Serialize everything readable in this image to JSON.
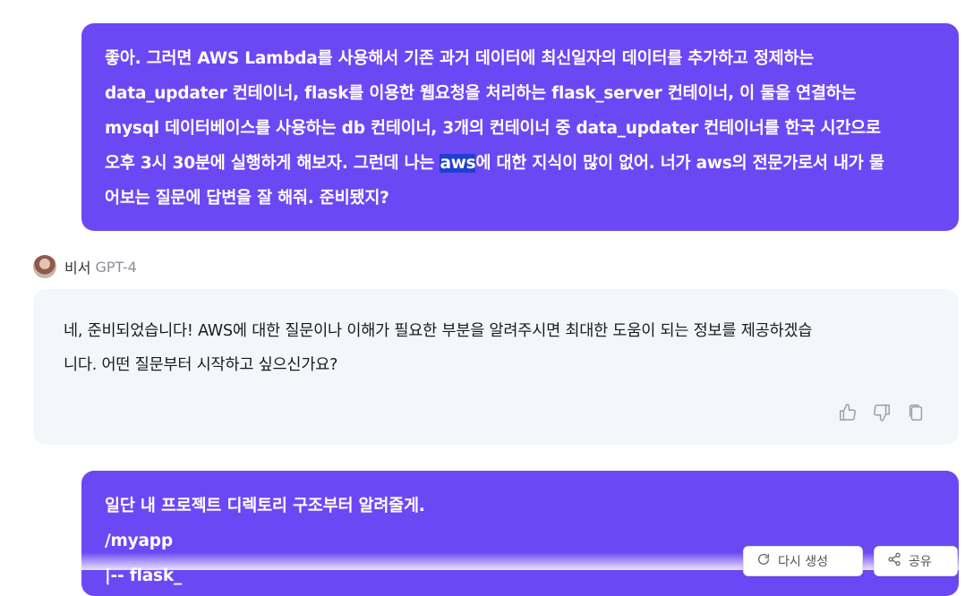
{
  "messages": {
    "user1": {
      "lines": [
        "좋아. 그러면 AWS Lambda를 사용해서 기존 과거 데이터에 최신일자의 데이터를 추가하고 정제하는",
        "data_updater 컨테이너,  flask를 이용한 웹요청을 처리하는 flask_server 컨테이너, 이 둘을 연결하는",
        "mysql 데이터베이스를 사용하는 db 컨테이너, 3개의 컨테이너 중 data_updater 컨테이너를 한국 시간으로"
      ],
      "line4_before": "오후 3시 30분에 실행하게 해보자. 그런데 나는 ",
      "line4_highlight": "aws",
      "line4_after": "에 대한 지식이 많이 없어. 너가 aws의 전문가로서 내가 물",
      "line5": "어보는 질문에 답변을 잘 해줘. 준비됐지?"
    },
    "assistant1": {
      "name": "비서",
      "model": "GPT-4",
      "lines": [
        "네, 준비되었습니다! AWS에 대한 질문이나 이해가 필요한 부분을 알려주시면 최대한 도움이 되는 정보를 제공하겠습",
        "니다. 어떤 질문부터 시작하고 싶으신가요?"
      ],
      "actions": [
        "thumbs-up-icon",
        "thumbs-down-icon",
        "copy-icon"
      ]
    },
    "user2": {
      "lines": [
        "일단 내 프로젝트 디렉토리 구조부터 알려줄게.",
        "/myapp",
        "|-- flask_"
      ]
    }
  },
  "floating_actions": {
    "regenerate": "다시 생성",
    "share": "공유"
  },
  "colors": {
    "user_bubble": "#6c48f5",
    "assistant_bubble": "#f3f6fb",
    "highlight": "#1f3fd1"
  }
}
